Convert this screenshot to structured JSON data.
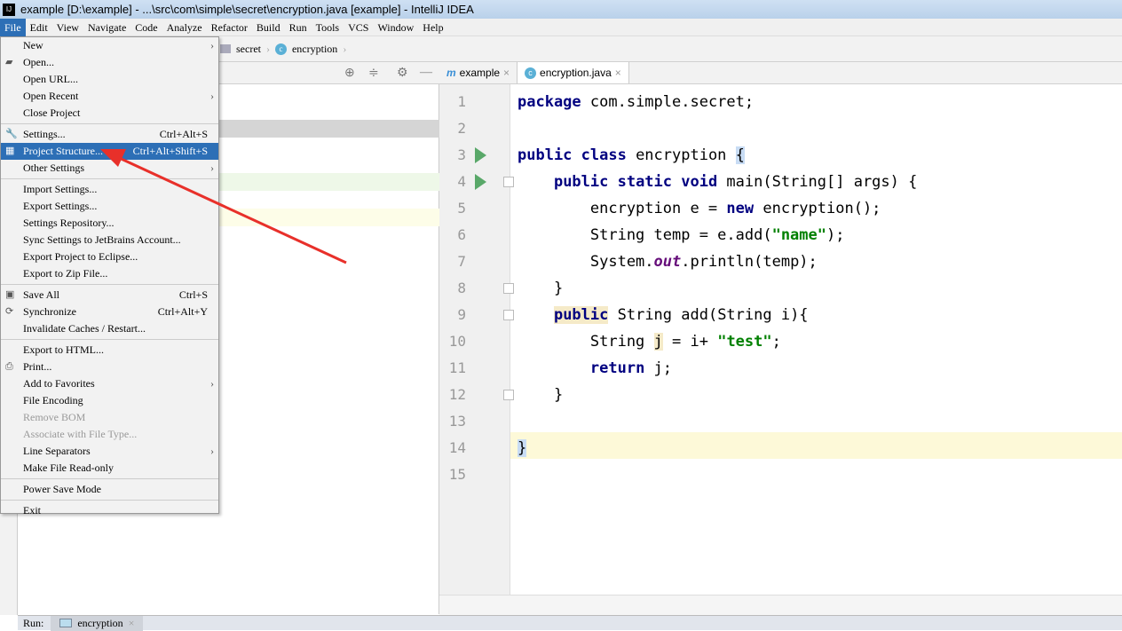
{
  "title": "example [D:\\example] - ...\\src\\com\\simple\\secret\\encryption.java [example] - IntelliJ IDEA",
  "logo_text": "IJ",
  "menubar": [
    "File",
    "Edit",
    "View",
    "Navigate",
    "Code",
    "Analyze",
    "Refactor",
    "Build",
    "Run",
    "Tools",
    "VCS",
    "Window",
    "Help"
  ],
  "breadcrumb": [
    "secret",
    "encryption"
  ],
  "tabs": [
    {
      "label": "example",
      "icon": "m"
    },
    {
      "label": "encryption.java",
      "icon": "c"
    }
  ],
  "file_menu": [
    {
      "label": "New",
      "sub": true
    },
    {
      "label": "Open...",
      "icon": "folder-icon"
    },
    {
      "label": "Open URL..."
    },
    {
      "label": "Open Recent",
      "sub": true
    },
    {
      "label": "Close Project"
    },
    {
      "sep": true
    },
    {
      "label": "Settings...",
      "shortcut": "Ctrl+Alt+S",
      "icon": "wrench-icon"
    },
    {
      "label": "Project Structure...",
      "shortcut": "Ctrl+Alt+Shift+S",
      "selected": true,
      "icon": "project-structure-icon"
    },
    {
      "label": "Other Settings",
      "sub": true
    },
    {
      "sep": true
    },
    {
      "label": "Import Settings..."
    },
    {
      "label": "Export Settings..."
    },
    {
      "label": "Settings Repository..."
    },
    {
      "label": "Sync Settings to JetBrains Account..."
    },
    {
      "label": "Export Project to Eclipse..."
    },
    {
      "label": "Export to Zip File..."
    },
    {
      "sep": true
    },
    {
      "label": "Save All",
      "shortcut": "Ctrl+S",
      "icon": "save-icon"
    },
    {
      "label": "Synchronize",
      "shortcut": "Ctrl+Alt+Y",
      "icon": "sync-icon"
    },
    {
      "label": "Invalidate Caches / Restart..."
    },
    {
      "sep": true
    },
    {
      "label": "Export to HTML..."
    },
    {
      "label": "Print...",
      "icon": "print-icon"
    },
    {
      "label": "Add to Favorites",
      "sub": true
    },
    {
      "label": "File Encoding"
    },
    {
      "label": "Remove BOM",
      "disabled": true
    },
    {
      "label": "Associate with File Type...",
      "disabled": true
    },
    {
      "label": "Line Separators",
      "sub": true
    },
    {
      "label": "Make File Read-only"
    },
    {
      "sep": true
    },
    {
      "label": "Power Save Mode"
    },
    {
      "sep": true
    },
    {
      "label": "Exit"
    }
  ],
  "code_lines": [
    "<span class='kw'>package</span> com.simple.secret;",
    "",
    "<span class='kw'>public class</span> encryption <span style='background:#c8dcf4'>{</span>",
    "    <span class='kw'>public static void</span> main(String[] args) {",
    "        encryption e = <span class='kw'>new</span> encryption();",
    "        String temp = e.add(<span class='str'>\"name\"</span>);",
    "        System.<span class='fld'>out</span>.println(temp);",
    "    }",
    "    <span class='kw' style='background:#f5eac8'>public</span> String add(String i){",
    "        String <span style='background:#f5eac8'>j</span> = i+ <span class='str'>\"test\"</span>;",
    "        <span class='kw'>return</span> j;",
    "    }",
    "",
    "<span style='background:#c8dcf4'>}</span>",
    ""
  ],
  "bottom": {
    "run_label": "Run:",
    "run_tab": "encryption"
  },
  "colors": {
    "accent": "#2d6fb6",
    "arrow": "#e8302a"
  }
}
